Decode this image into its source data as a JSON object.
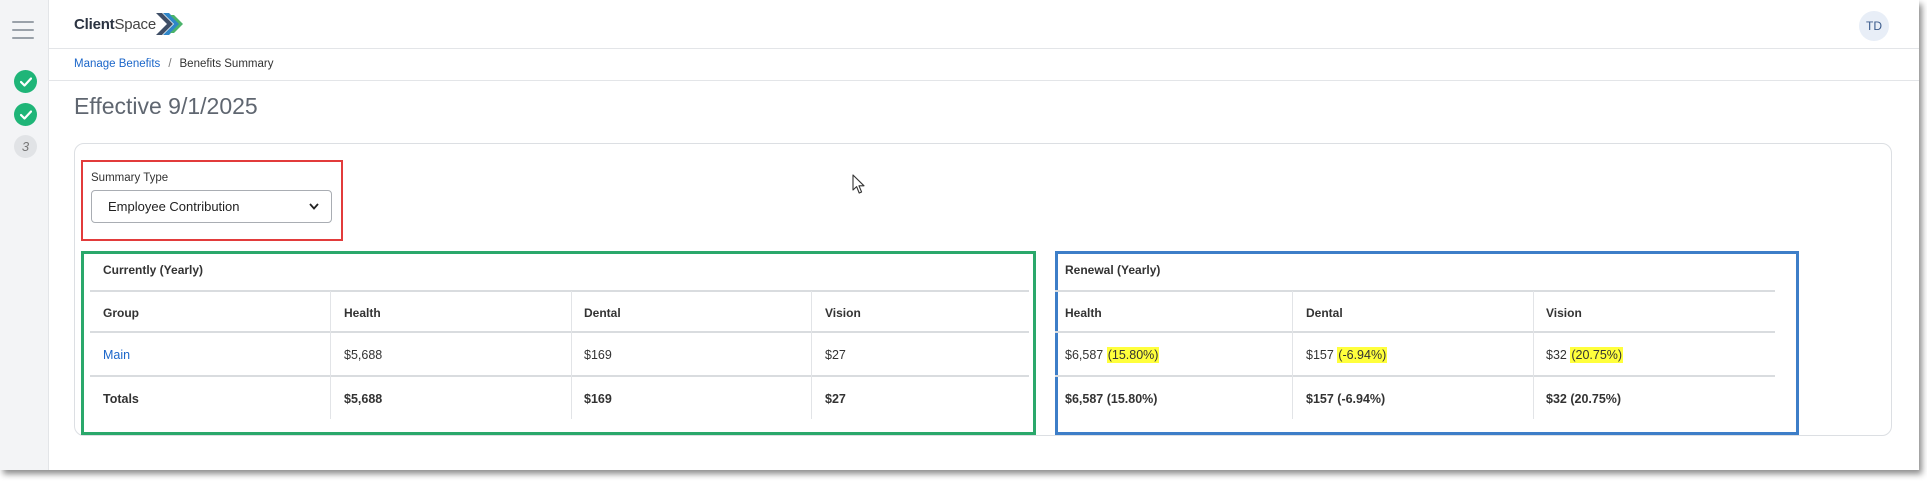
{
  "app": {
    "logo_bold": "Client",
    "logo_thin": "Space",
    "avatar_initials": "TD"
  },
  "steps": [
    {
      "state": "done"
    },
    {
      "state": "done"
    },
    {
      "state": "todo",
      "label": "3"
    }
  ],
  "breadcrumb": {
    "parent": "Manage Benefits",
    "separator": "/",
    "current": "Benefits Summary"
  },
  "page": {
    "title": "Effective 9/1/2025"
  },
  "summary_type": {
    "label": "Summary Type",
    "value": "Employee Contribution"
  },
  "current": {
    "title": "Currently (Yearly)",
    "headers": [
      "Group",
      "Health",
      "Dental",
      "Vision"
    ],
    "rows": [
      {
        "group": "Main",
        "health": "$5,688",
        "dental": "$169",
        "vision": "$27"
      }
    ],
    "totals": {
      "label": "Totals",
      "health": "$5,688",
      "dental": "$169",
      "vision": "$27"
    }
  },
  "renewal": {
    "title": "Renewal (Yearly)",
    "headers": [
      "Health",
      "Dental",
      "Vision"
    ],
    "rows": [
      {
        "health": "$6,587",
        "health_pct": "(15.80%)",
        "dental": "$157",
        "dental_pct": "(-6.94%)",
        "vision": "$32",
        "vision_pct": "(20.75%)"
      }
    ],
    "totals": {
      "health": "$6,587 (15.80%)",
      "dental": "$157 (-6.94%)",
      "vision": "$32 (20.75%)"
    }
  },
  "colors": {
    "accent_link": "#1b66c9",
    "step_done": "#1fb578",
    "highlight": "#ffff3c",
    "box_red": "#e23b3b",
    "box_green": "#2aa86b",
    "box_blue": "#3d7ec8"
  }
}
